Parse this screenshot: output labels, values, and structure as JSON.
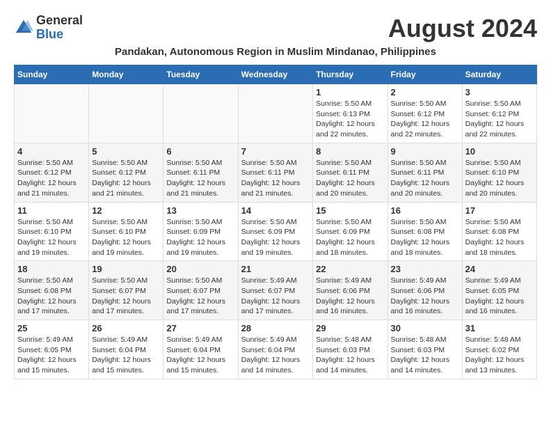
{
  "header": {
    "logo_general": "General",
    "logo_blue": "Blue",
    "title": "August 2024",
    "subtitle": "Pandakan, Autonomous Region in Muslim Mindanao, Philippines"
  },
  "weekdays": [
    "Sunday",
    "Monday",
    "Tuesday",
    "Wednesday",
    "Thursday",
    "Friday",
    "Saturday"
  ],
  "weeks": [
    [
      {
        "day": "",
        "info": ""
      },
      {
        "day": "",
        "info": ""
      },
      {
        "day": "",
        "info": ""
      },
      {
        "day": "",
        "info": ""
      },
      {
        "day": "1",
        "info": "Sunrise: 5:50 AM\nSunset: 6:13 PM\nDaylight: 12 hours\nand 22 minutes."
      },
      {
        "day": "2",
        "info": "Sunrise: 5:50 AM\nSunset: 6:12 PM\nDaylight: 12 hours\nand 22 minutes."
      },
      {
        "day": "3",
        "info": "Sunrise: 5:50 AM\nSunset: 6:12 PM\nDaylight: 12 hours\nand 22 minutes."
      }
    ],
    [
      {
        "day": "4",
        "info": "Sunrise: 5:50 AM\nSunset: 6:12 PM\nDaylight: 12 hours\nand 21 minutes."
      },
      {
        "day": "5",
        "info": "Sunrise: 5:50 AM\nSunset: 6:12 PM\nDaylight: 12 hours\nand 21 minutes."
      },
      {
        "day": "6",
        "info": "Sunrise: 5:50 AM\nSunset: 6:11 PM\nDaylight: 12 hours\nand 21 minutes."
      },
      {
        "day": "7",
        "info": "Sunrise: 5:50 AM\nSunset: 6:11 PM\nDaylight: 12 hours\nand 21 minutes."
      },
      {
        "day": "8",
        "info": "Sunrise: 5:50 AM\nSunset: 6:11 PM\nDaylight: 12 hours\nand 20 minutes."
      },
      {
        "day": "9",
        "info": "Sunrise: 5:50 AM\nSunset: 6:11 PM\nDaylight: 12 hours\nand 20 minutes."
      },
      {
        "day": "10",
        "info": "Sunrise: 5:50 AM\nSunset: 6:10 PM\nDaylight: 12 hours\nand 20 minutes."
      }
    ],
    [
      {
        "day": "11",
        "info": "Sunrise: 5:50 AM\nSunset: 6:10 PM\nDaylight: 12 hours\nand 19 minutes."
      },
      {
        "day": "12",
        "info": "Sunrise: 5:50 AM\nSunset: 6:10 PM\nDaylight: 12 hours\nand 19 minutes."
      },
      {
        "day": "13",
        "info": "Sunrise: 5:50 AM\nSunset: 6:09 PM\nDaylight: 12 hours\nand 19 minutes."
      },
      {
        "day": "14",
        "info": "Sunrise: 5:50 AM\nSunset: 6:09 PM\nDaylight: 12 hours\nand 19 minutes."
      },
      {
        "day": "15",
        "info": "Sunrise: 5:50 AM\nSunset: 6:09 PM\nDaylight: 12 hours\nand 18 minutes."
      },
      {
        "day": "16",
        "info": "Sunrise: 5:50 AM\nSunset: 6:08 PM\nDaylight: 12 hours\nand 18 minutes."
      },
      {
        "day": "17",
        "info": "Sunrise: 5:50 AM\nSunset: 6:08 PM\nDaylight: 12 hours\nand 18 minutes."
      }
    ],
    [
      {
        "day": "18",
        "info": "Sunrise: 5:50 AM\nSunset: 6:08 PM\nDaylight: 12 hours\nand 17 minutes."
      },
      {
        "day": "19",
        "info": "Sunrise: 5:50 AM\nSunset: 6:07 PM\nDaylight: 12 hours\nand 17 minutes."
      },
      {
        "day": "20",
        "info": "Sunrise: 5:50 AM\nSunset: 6:07 PM\nDaylight: 12 hours\nand 17 minutes."
      },
      {
        "day": "21",
        "info": "Sunrise: 5:49 AM\nSunset: 6:07 PM\nDaylight: 12 hours\nand 17 minutes."
      },
      {
        "day": "22",
        "info": "Sunrise: 5:49 AM\nSunset: 6:06 PM\nDaylight: 12 hours\nand 16 minutes."
      },
      {
        "day": "23",
        "info": "Sunrise: 5:49 AM\nSunset: 6:06 PM\nDaylight: 12 hours\nand 16 minutes."
      },
      {
        "day": "24",
        "info": "Sunrise: 5:49 AM\nSunset: 6:05 PM\nDaylight: 12 hours\nand 16 minutes."
      }
    ],
    [
      {
        "day": "25",
        "info": "Sunrise: 5:49 AM\nSunset: 6:05 PM\nDaylight: 12 hours\nand 15 minutes."
      },
      {
        "day": "26",
        "info": "Sunrise: 5:49 AM\nSunset: 6:04 PM\nDaylight: 12 hours\nand 15 minutes."
      },
      {
        "day": "27",
        "info": "Sunrise: 5:49 AM\nSunset: 6:04 PM\nDaylight: 12 hours\nand 15 minutes."
      },
      {
        "day": "28",
        "info": "Sunrise: 5:49 AM\nSunset: 6:04 PM\nDaylight: 12 hours\nand 14 minutes."
      },
      {
        "day": "29",
        "info": "Sunrise: 5:48 AM\nSunset: 6:03 PM\nDaylight: 12 hours\nand 14 minutes."
      },
      {
        "day": "30",
        "info": "Sunrise: 5:48 AM\nSunset: 6:03 PM\nDaylight: 12 hours\nand 14 minutes."
      },
      {
        "day": "31",
        "info": "Sunrise: 5:48 AM\nSunset: 6:02 PM\nDaylight: 12 hours\nand 13 minutes."
      }
    ]
  ]
}
